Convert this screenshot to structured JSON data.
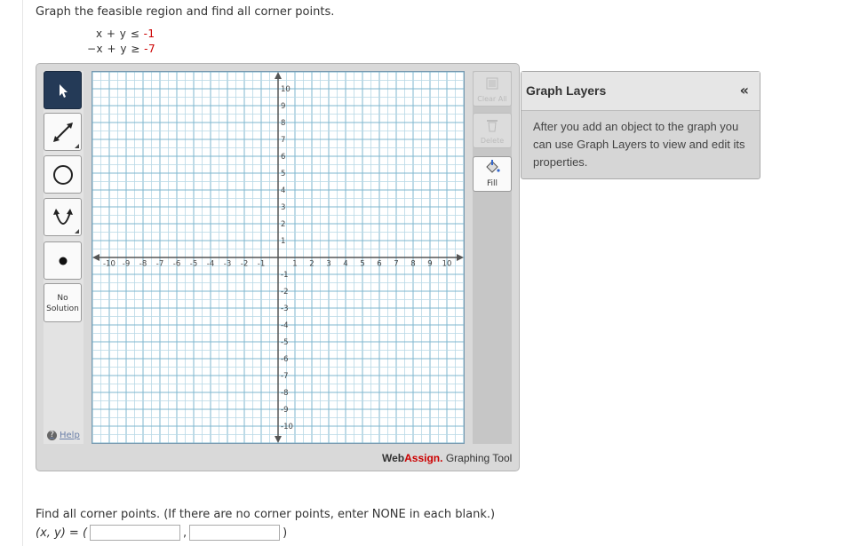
{
  "question": {
    "prompt": "Graph the feasible region and find all corner points.",
    "inequalities": [
      {
        "lhs": "x + y ≤ ",
        "rhs": "-1"
      },
      {
        "lhs": "−x + y ≥ ",
        "rhs": "-7"
      }
    ]
  },
  "toolbar": {
    "tools": [
      "pointer-icon",
      "line-icon",
      "circle-icon",
      "parabola-icon",
      "point-icon"
    ],
    "active_tool": "pointer-icon",
    "no_solution_line1": "No",
    "no_solution_line2": "Solution",
    "help_label": "Help"
  },
  "graph": {
    "x_ticks": [
      "-10",
      "-9",
      "-8",
      "-7",
      "-6",
      "-5",
      "-4",
      "-3",
      "-2",
      "-1",
      "1",
      "2",
      "3",
      "4",
      "5",
      "6",
      "7",
      "8",
      "9",
      "10"
    ],
    "y_ticks": [
      "10",
      "9",
      "8",
      "7",
      "6",
      "5",
      "4",
      "3",
      "2",
      "1",
      "-1",
      "-2",
      "-3",
      "-4",
      "-5",
      "-6",
      "-7",
      "-8",
      "-9",
      "-10"
    ],
    "x_range": [
      -10,
      10
    ],
    "y_range": [
      -10,
      10
    ],
    "minor_step": 0.5,
    "major_step": 1,
    "colors": {
      "minor": "#b8d8e6",
      "major": "#7fb7cf",
      "axis": "#555555"
    }
  },
  "right_tools": {
    "clear_all": "Clear All",
    "delete": "Delete",
    "fill": "Fill"
  },
  "brand": {
    "web": "Web",
    "assign": "Assign.",
    "tool": "Graphing Tool"
  },
  "layers": {
    "title": "Graph Layers",
    "collapse": "«",
    "description": "After you add an object to the graph you can use Graph Layers to view and edit its properties."
  },
  "answer": {
    "question": "Find all corner points. (If there are no corner points, enter NONE in each blank.)",
    "label": "(x, y) = (",
    "separator": ",",
    "close": ")",
    "x_value": "",
    "y_value": ""
  }
}
